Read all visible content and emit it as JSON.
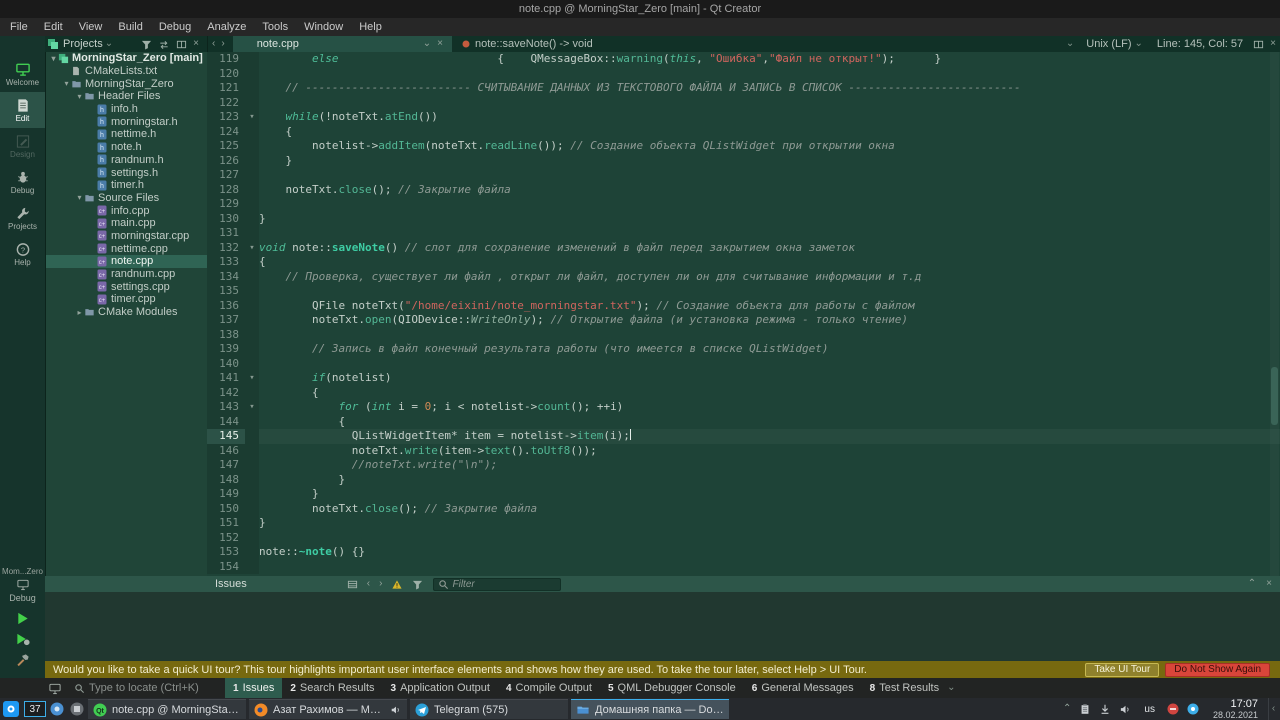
{
  "window": {
    "title": "note.cpp @ MorningStar_Zero [main] - Qt Creator"
  },
  "menubar": {
    "items": [
      "File",
      "Edit",
      "View",
      "Build",
      "Debug",
      "Analyze",
      "Tools",
      "Window",
      "Help"
    ]
  },
  "topbar": {
    "pane_selector": "Projects",
    "pane_header_icons": [
      "funnel-icon",
      "sync-icon",
      "split-icon",
      "close-icon"
    ],
    "tab_nav_icons": [
      "back-icon",
      "forward-icon"
    ],
    "tab_label": "note.cpp",
    "tab_icons": [
      "dropdown-icon",
      "close-icon"
    ],
    "breadcrumb": "note::saveNote() -> void",
    "encoding": "Unix (LF)",
    "cursor_position": "Line: 145, Col: 57",
    "corner_icons": [
      "split-icon",
      "close-icon"
    ]
  },
  "modebar": {
    "modes": [
      {
        "label": "Welcome",
        "icon": "welcome-icon",
        "state": "normal"
      },
      {
        "label": "Edit",
        "icon": "edit-icon",
        "state": "active"
      },
      {
        "label": "Design",
        "icon": "design-icon",
        "state": "disabled"
      },
      {
        "label": "Debug",
        "icon": "debug-icon",
        "state": "normal"
      },
      {
        "label": "Projects",
        "icon": "wrench-icon",
        "state": "normal"
      },
      {
        "label": "Help",
        "icon": "help-icon",
        "state": "normal"
      }
    ],
    "kit_label": "Mom...Zero",
    "build_config": "Debug",
    "run_controls": [
      "run-icon",
      "run-debug-icon",
      "build-icon"
    ]
  },
  "project_tree": [
    {
      "depth": 0,
      "arrow": "open",
      "icon": "project",
      "label": "MorningStar_Zero [main]",
      "bold": true
    },
    {
      "depth": 1,
      "arrow": "none",
      "icon": "file",
      "label": "CMakeLists.txt"
    },
    {
      "depth": 1,
      "arrow": "open",
      "icon": "folder",
      "label": "MorningStar_Zero"
    },
    {
      "depth": 2,
      "arrow": "open",
      "icon": "folder",
      "label": "Header Files"
    },
    {
      "depth": 3,
      "arrow": "none",
      "icon": "h",
      "label": "info.h"
    },
    {
      "depth": 3,
      "arrow": "none",
      "icon": "h",
      "label": "morningstar.h"
    },
    {
      "depth": 3,
      "arrow": "none",
      "icon": "h",
      "label": "nettime.h"
    },
    {
      "depth": 3,
      "arrow": "none",
      "icon": "h",
      "label": "note.h"
    },
    {
      "depth": 3,
      "arrow": "none",
      "icon": "h",
      "label": "randnum.h"
    },
    {
      "depth": 3,
      "arrow": "none",
      "icon": "h",
      "label": "settings.h"
    },
    {
      "depth": 3,
      "arrow": "none",
      "icon": "h",
      "label": "timer.h"
    },
    {
      "depth": 2,
      "arrow": "open",
      "icon": "folder",
      "label": "Source Files"
    },
    {
      "depth": 3,
      "arrow": "none",
      "icon": "cpp",
      "label": "info.cpp"
    },
    {
      "depth": 3,
      "arrow": "none",
      "icon": "cpp",
      "label": "main.cpp"
    },
    {
      "depth": 3,
      "arrow": "none",
      "icon": "cpp",
      "label": "morningstar.cpp"
    },
    {
      "depth": 3,
      "arrow": "none",
      "icon": "cpp",
      "label": "nettime.cpp"
    },
    {
      "depth": 3,
      "arrow": "none",
      "icon": "cpp",
      "label": "note.cpp",
      "selected": true
    },
    {
      "depth": 3,
      "arrow": "none",
      "icon": "cpp",
      "label": "randnum.cpp"
    },
    {
      "depth": 3,
      "arrow": "none",
      "icon": "cpp",
      "label": "settings.cpp"
    },
    {
      "depth": 3,
      "arrow": "none",
      "icon": "cpp",
      "label": "timer.cpp"
    },
    {
      "depth": 2,
      "arrow": "closed",
      "icon": "folder",
      "label": "CMake Modules"
    }
  ],
  "editor": {
    "current_line": 145,
    "lines": [
      {
        "n": 119,
        "tokens": [
          [
            "t",
            "        "
          ],
          [
            "k",
            "else"
          ],
          [
            "t",
            "                        {    "
          ],
          [
            "t",
            "QMessageBox::"
          ],
          [
            "f",
            "warning"
          ],
          [
            "t",
            "("
          ],
          [
            "k",
            "this"
          ],
          [
            "t",
            ", "
          ],
          [
            "s",
            "\"Ошибка\""
          ],
          [
            "t",
            ","
          ],
          [
            "s",
            "\"Файл не открыт!\""
          ],
          [
            "t",
            ");      }"
          ]
        ]
      },
      {
        "n": 120,
        "tokens": []
      },
      {
        "n": 121,
        "tokens": [
          [
            "t",
            "    "
          ],
          [
            "c",
            "// ------------------------- СЧИТЫВАНИЕ ДАННЫХ ИЗ ТЕКСТОВОГО ФАЙЛА И ЗАПИСЬ В СПИСОК --------------------------"
          ]
        ]
      },
      {
        "n": 122,
        "tokens": []
      },
      {
        "n": 123,
        "fold": true,
        "tokens": [
          [
            "t",
            "    "
          ],
          [
            "k",
            "while"
          ],
          [
            "t",
            "(!noteTxt."
          ],
          [
            "f",
            "atEnd"
          ],
          [
            "t",
            "())"
          ]
        ]
      },
      {
        "n": 124,
        "tokens": [
          [
            "t",
            "    {"
          ]
        ]
      },
      {
        "n": 125,
        "tokens": [
          [
            "t",
            "        notelist->"
          ],
          [
            "f",
            "addItem"
          ],
          [
            "t",
            "(noteTxt."
          ],
          [
            "f",
            "readLine"
          ],
          [
            "t",
            "()); "
          ],
          [
            "c",
            "// Создание объекта QListWidget при открытии окна"
          ]
        ]
      },
      {
        "n": 126,
        "tokens": [
          [
            "t",
            "    }"
          ]
        ]
      },
      {
        "n": 127,
        "tokens": []
      },
      {
        "n": 128,
        "tokens": [
          [
            "t",
            "    noteTxt."
          ],
          [
            "f",
            "close"
          ],
          [
            "t",
            "(); "
          ],
          [
            "c",
            "// Закрытие файла"
          ]
        ]
      },
      {
        "n": 129,
        "tokens": []
      },
      {
        "n": 130,
        "tokens": [
          [
            "t",
            "}"
          ]
        ]
      },
      {
        "n": 131,
        "tokens": []
      },
      {
        "n": 132,
        "fold": true,
        "tokens": [
          [
            "k",
            "void"
          ],
          [
            "t",
            " note::"
          ],
          [
            "d",
            "saveNote"
          ],
          [
            "t",
            "() "
          ],
          [
            "c",
            "// слот для сохранение изменений в файл перед закрытием окна заметок"
          ]
        ]
      },
      {
        "n": 133,
        "tokens": [
          [
            "t",
            "{"
          ]
        ]
      },
      {
        "n": 134,
        "tokens": [
          [
            "t",
            "    "
          ],
          [
            "c",
            "// Проверка, существует ли файл , открыт ли файл, доступен ли он для считывание информации и т.д"
          ]
        ]
      },
      {
        "n": 135,
        "tokens": []
      },
      {
        "n": 136,
        "tokens": [
          [
            "t",
            "        QFile noteTxt("
          ],
          [
            "s",
            "\"/home/eixini/note_morningstar.txt\""
          ],
          [
            "t",
            "); "
          ],
          [
            "c",
            "// Создание объекта для работы с файлом"
          ]
        ]
      },
      {
        "n": 137,
        "tokens": [
          [
            "t",
            "        noteTxt."
          ],
          [
            "f",
            "open"
          ],
          [
            "t",
            "(QIODevice::"
          ],
          [
            "e",
            "WriteOnly"
          ],
          [
            "t",
            "); "
          ],
          [
            "c",
            "// Открытие файла (и установка режима - только чтение)"
          ]
        ]
      },
      {
        "n": 138,
        "tokens": []
      },
      {
        "n": 139,
        "tokens": [
          [
            "t",
            "        "
          ],
          [
            "c",
            "// Запись в файл конечный результата работы (что имеется в списке QListWidget)"
          ]
        ]
      },
      {
        "n": 140,
        "tokens": []
      },
      {
        "n": 141,
        "fold": true,
        "tokens": [
          [
            "t",
            "        "
          ],
          [
            "k",
            "if"
          ],
          [
            "t",
            "(notelist)"
          ]
        ]
      },
      {
        "n": 142,
        "tokens": [
          [
            "t",
            "        {"
          ]
        ]
      },
      {
        "n": 143,
        "fold": true,
        "tokens": [
          [
            "t",
            "            "
          ],
          [
            "k",
            "for"
          ],
          [
            "t",
            " ("
          ],
          [
            "k",
            "int"
          ],
          [
            "t",
            " i = "
          ],
          [
            "n",
            "0"
          ],
          [
            "t",
            "; i < notelist->"
          ],
          [
            "f",
            "count"
          ],
          [
            "t",
            "(); ++i)"
          ]
        ]
      },
      {
        "n": 144,
        "tokens": [
          [
            "t",
            "            {"
          ]
        ]
      },
      {
        "n": 145,
        "caret": true,
        "tokens": [
          [
            "t",
            "              QListWidgetItem* item = notelist->"
          ],
          [
            "f",
            "item"
          ],
          [
            "t",
            "(i);"
          ]
        ]
      },
      {
        "n": 146,
        "tokens": [
          [
            "t",
            "              noteTxt."
          ],
          [
            "f",
            "write"
          ],
          [
            "t",
            "(item->"
          ],
          [
            "f",
            "text"
          ],
          [
            "t",
            "()."
          ],
          [
            "f",
            "toUtf8"
          ],
          [
            "t",
            "());"
          ]
        ]
      },
      {
        "n": 147,
        "tokens": [
          [
            "t",
            "              "
          ],
          [
            "c",
            "//noteTxt.write(\"\\n\");"
          ]
        ]
      },
      {
        "n": 148,
        "tokens": [
          [
            "t",
            "            }"
          ]
        ]
      },
      {
        "n": 149,
        "tokens": [
          [
            "t",
            "        }"
          ]
        ]
      },
      {
        "n": 150,
        "tokens": [
          [
            "t",
            "        noteTxt."
          ],
          [
            "f",
            "close"
          ],
          [
            "t",
            "(); "
          ],
          [
            "c",
            "// Закрытие файла"
          ]
        ]
      },
      {
        "n": 151,
        "tokens": [
          [
            "t",
            "}"
          ]
        ]
      },
      {
        "n": 152,
        "tokens": []
      },
      {
        "n": 153,
        "tokens": [
          [
            "t",
            "note::"
          ],
          [
            "d",
            "~note"
          ],
          [
            "t",
            "() {}"
          ]
        ]
      },
      {
        "n": 154,
        "tokens": []
      }
    ]
  },
  "issues_pane": {
    "title": "Issues",
    "toolbar_icons": [
      "table-icon",
      "back-icon",
      "forward-icon",
      "warning-filter-icon",
      "funnel-icon"
    ],
    "filter_placeholder": "Filter",
    "corner_icons": [
      "chevron-up-icon",
      "close-icon"
    ]
  },
  "notification": {
    "message": "Would you like to take a quick UI tour? This tour highlights important user interface elements and shows how they are used. To take the tour later, select Help > UI Tour.",
    "primary_button": "Take UI Tour",
    "secondary_button": "Do Not Show Again"
  },
  "statusbar": {
    "locator_placeholder": "Type to locate (Ctrl+K)",
    "panes": [
      {
        "key": "1",
        "label": "Issues",
        "active": true
      },
      {
        "key": "2",
        "label": "Search Results",
        "active": false
      },
      {
        "key": "3",
        "label": "Application Output",
        "active": false
      },
      {
        "key": "4",
        "label": "Compile Output",
        "active": false
      },
      {
        "key": "5",
        "label": "QML Debugger Console",
        "active": false
      },
      {
        "key": "6",
        "label": "General Messages",
        "active": false
      },
      {
        "key": "8",
        "label": "Test Results",
        "active": false
      }
    ]
  },
  "taskbar": {
    "pager": "37",
    "launcher_icons": [
      "blue-app-icon",
      "gray-app-icon"
    ],
    "windows": [
      {
        "icon": "qtcreator-icon",
        "title": "note.cpp @ MorningStar_Zer...",
        "active": false,
        "audio": false
      },
      {
        "icon": "firefox-icon",
        "title": "Азат Рахимов — Mozilla ...",
        "active": false,
        "audio": true
      },
      {
        "icon": "telegram-icon",
        "title": "Telegram (575)",
        "active": false,
        "audio": false
      },
      {
        "icon": "dolphin-icon",
        "title": "Домашняя папка — Dolphin",
        "active": true,
        "audio": false
      }
    ],
    "tray_icons": [
      "chevron-up-icon",
      "clipboard-icon",
      "download-icon",
      "volume-icon"
    ],
    "keyboard_layout": "us",
    "tray_badges": [
      "red-badge-icon",
      "blue-badge-icon"
    ],
    "time": "17:07",
    "date": "28.02.2021"
  },
  "colors": {
    "accent_teal": "#2e5c4e",
    "qt_green": "#41cd52",
    "notification_bg": "#77690f",
    "danger_red": "#d9453a",
    "taskbar_accent": "#3daee9"
  }
}
